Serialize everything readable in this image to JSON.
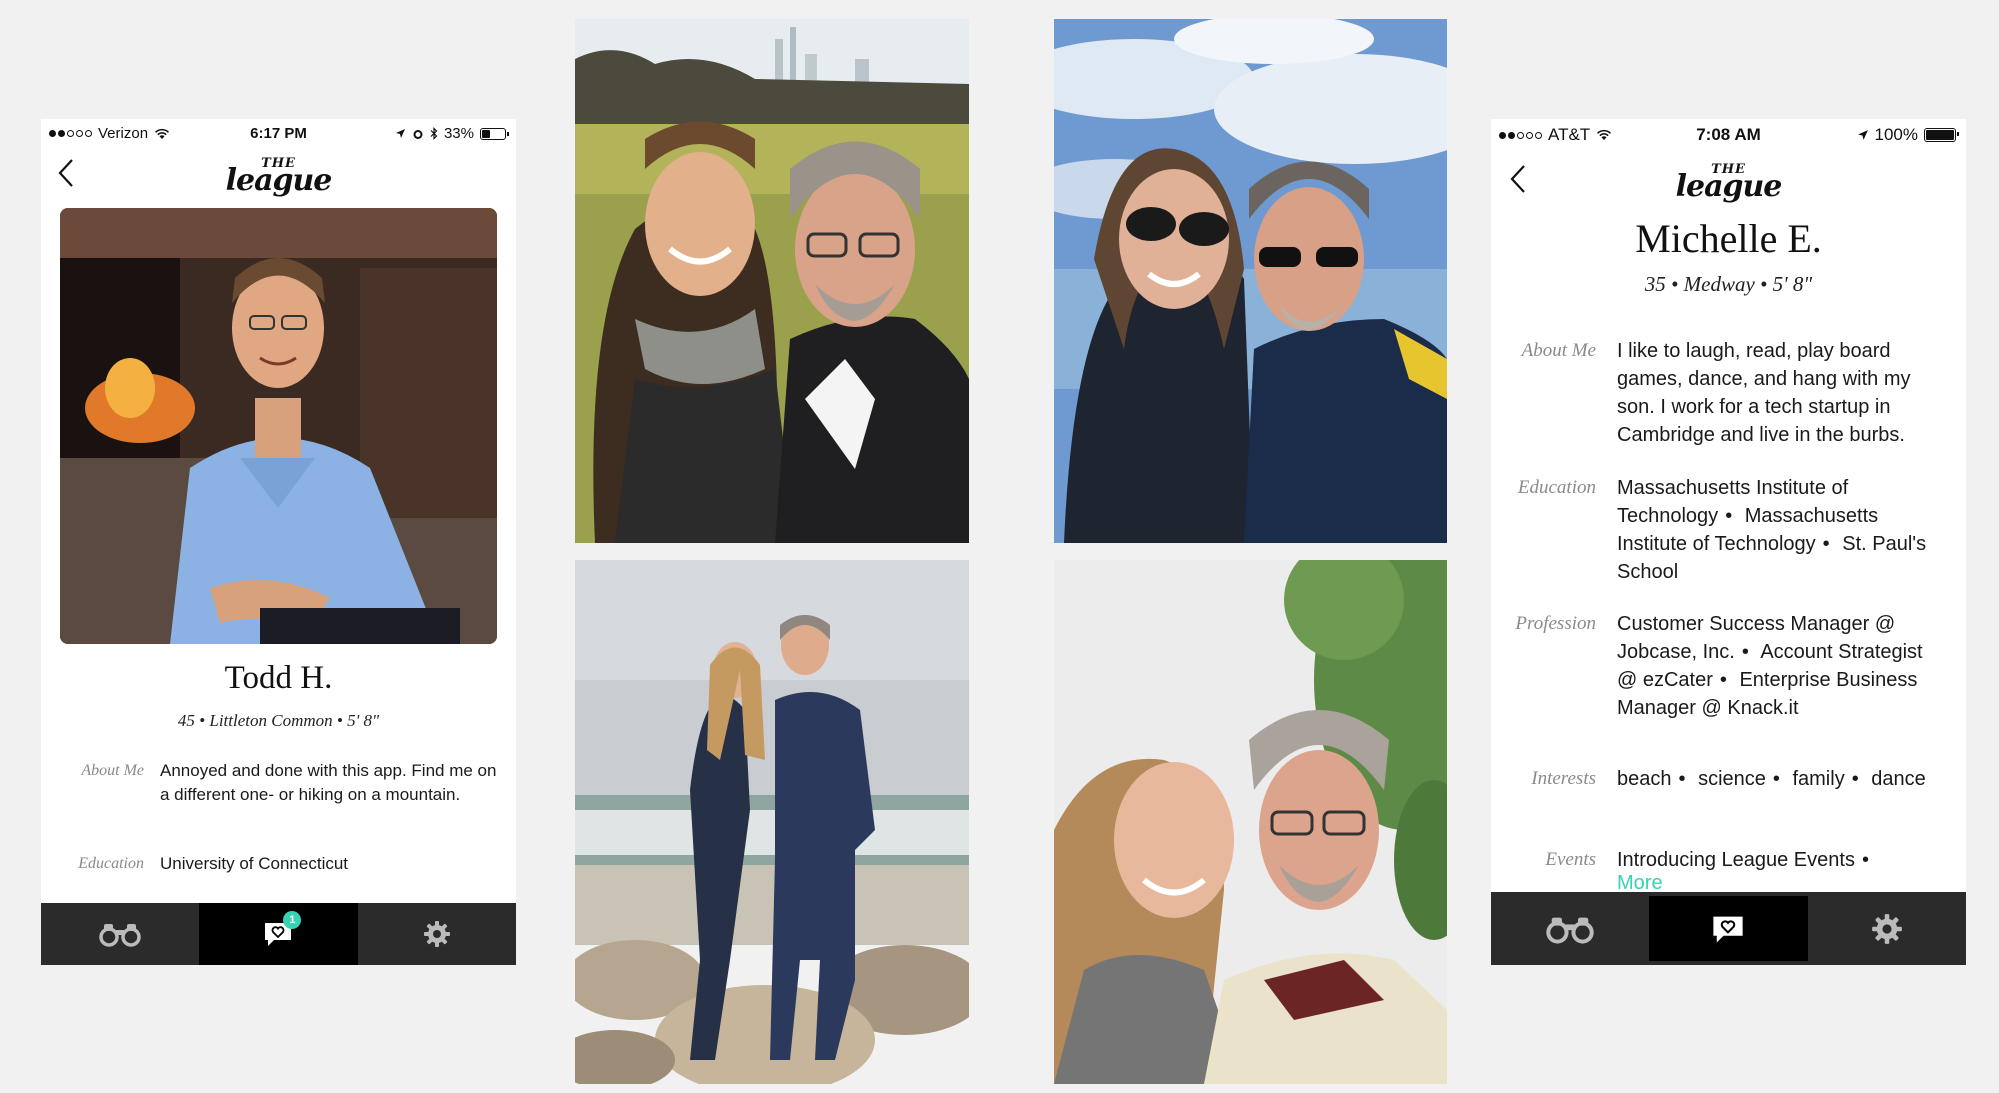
{
  "left_phone": {
    "status": {
      "carrier": "Verizon",
      "time": "6:17 PM",
      "battery": "33%",
      "battery_level": 0.33
    },
    "logo": {
      "the": "THE",
      "word": "league"
    },
    "name": "Todd H.",
    "subline": "45 • Littleton Common • 5' 8\"",
    "about": {
      "label": "About Me",
      "value": "Annoyed and done with this app. Find me on a different one- or hiking on a mountain."
    },
    "education": {
      "label": "Education",
      "value": "University of Connecticut"
    },
    "tabs": {
      "badge": "1"
    }
  },
  "right_phone": {
    "status": {
      "carrier": "AT&T",
      "time": "7:08 AM",
      "battery": "100%",
      "battery_level": 1.0
    },
    "logo": {
      "the": "THE",
      "word": "league"
    },
    "name": "Michelle E.",
    "subline": "35 • Medway • 5' 8\"",
    "rows": [
      {
        "label": "About Me",
        "values": [
          "I like to laugh, read, play board games, dance, and hang with my son. I work for a tech startup in Cambridge and live in the burbs."
        ]
      },
      {
        "label": "Education",
        "values": [
          "Massachusetts Institute of Technology",
          "Massachusetts Institute of Technology",
          "St. Paul's School"
        ]
      },
      {
        "label": "Profession",
        "values": [
          "Customer Success Manager @ Jobcase, Inc.",
          "Account Strategist @ ezCater",
          "Enterprise Business Manager @ Knack.it"
        ]
      },
      {
        "label": "Interests",
        "values": [
          "beach",
          "science",
          "family",
          "dance"
        ]
      },
      {
        "label": "Events",
        "values": [
          "Introducing League Events"
        ]
      }
    ],
    "more_link": "More"
  },
  "colors": {
    "accent": "#37d3b2",
    "tabbar": "#2b2b2b",
    "tab_active": "#000000",
    "label": "#8a8a8a",
    "background": "#f1f1f2"
  },
  "icons": {
    "discover": "binoculars-icon",
    "messages": "chat-heart-icon",
    "settings": "gear-icon",
    "back": "chevron-left-icon"
  }
}
